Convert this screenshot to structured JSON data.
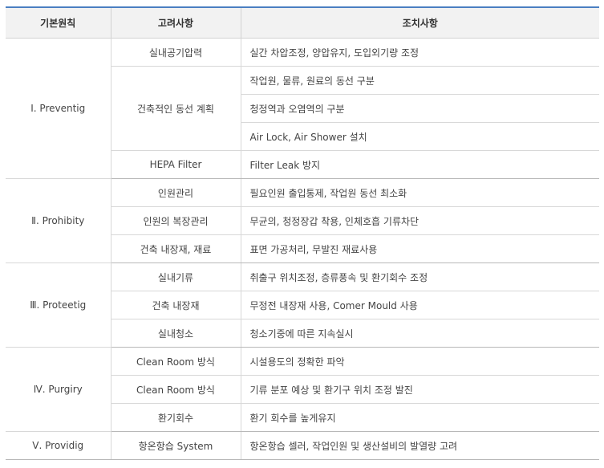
{
  "headers": [
    "기본원칙",
    "고려사항",
    "조치사항"
  ],
  "groups": [
    {
      "principle": "Ⅰ. Preventig",
      "rows": [
        {
          "consider": "실내공기압력",
          "actions": [
            "실간 차압조정, 양압유지, 도입외기량 조정"
          ]
        },
        {
          "consider": "건축적인 동선 계획",
          "actions": [
            "작업원, 물류, 원료의 동선 구분",
            "청정역과 오염역의 구분",
            "Air Lock, Air Shower 설치"
          ]
        },
        {
          "consider": "HEPA Filter",
          "actions": [
            "Filter Leak 방지"
          ]
        }
      ]
    },
    {
      "principle": "Ⅱ. Prohibity",
      "rows": [
        {
          "consider": "인원관리",
          "actions": [
            "필요인원 출입통제, 작업원 동선 최소화"
          ]
        },
        {
          "consider": "인원의 복장관리",
          "actions": [
            "무균의, 청정장갑 착용, 인체호흡 기류차단"
          ]
        },
        {
          "consider": "건축 내장재, 재료",
          "actions": [
            "표면 가공처리, 무발진 재료사용"
          ]
        }
      ]
    },
    {
      "principle": "Ⅲ. Proteetig",
      "rows": [
        {
          "consider": "실내기류",
          "actions": [
            "취출구 위치조정, 층류풍속 및 환기회수 조정"
          ]
        },
        {
          "consider": "건축 내장재",
          "actions": [
            "무정전 내장재 사용, Comer Mould 사용"
          ]
        },
        {
          "consider": "실내청소",
          "actions": [
            "청소기중에 따른 지속실시"
          ]
        }
      ]
    },
    {
      "principle": "Ⅳ. Purgiry",
      "rows": [
        {
          "consider": "Clean Room 방식",
          "actions": [
            "시설용도의 정확한 파악"
          ]
        },
        {
          "consider": "Clean Room 방식",
          "actions": [
            "기류 분포 예상 및 환기구 위치 조정 발진"
          ]
        },
        {
          "consider": "환기회수",
          "actions": [
            "환기 회수를 높게유지"
          ]
        }
      ]
    },
    {
      "principle": "Ⅴ. Providig",
      "rows": [
        {
          "consider": "항온항습 System",
          "actions": [
            "항온항습 셀러, 작업인원 및 생산설비의 발열량 고려"
          ]
        }
      ]
    }
  ]
}
